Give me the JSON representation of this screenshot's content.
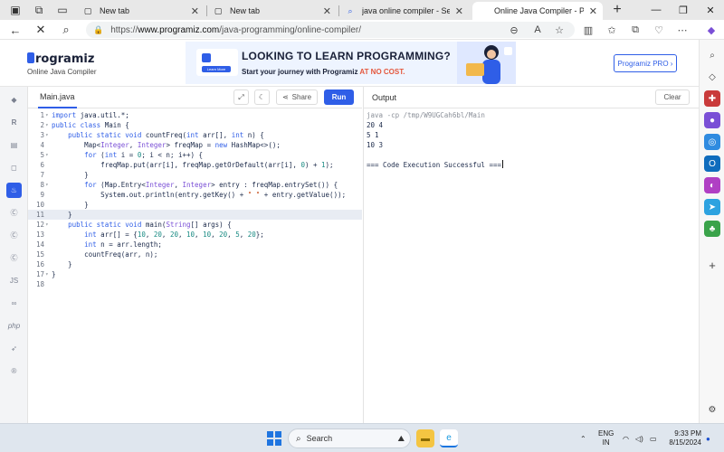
{
  "browser": {
    "tabs": [
      {
        "title": "New tab",
        "favicon": "page-icon"
      },
      {
        "title": "New tab",
        "favicon": "page-icon"
      },
      {
        "title": "java online compiler - Search",
        "favicon": "search-icon"
      },
      {
        "title": "Online Java Compiler - Program",
        "favicon": "programiz-icon",
        "active": true
      }
    ],
    "url_protocol": "https://",
    "url_host": "www.programiz.com",
    "url_path": "/java-programming/online-compiler/",
    "window_controls": [
      "—",
      "❐",
      "✕"
    ]
  },
  "site": {
    "logo_text": "rogramiz",
    "logo_sub": "Online Java Compiler",
    "banner": {
      "headline": "LOOKING TO LEARN PROGRAMMING?",
      "sub_prefix": "Start your journey with Programiz ",
      "sub_highlight": "AT NO COST.",
      "mini_button": "Learn More"
    },
    "pro_button": "Programiz PRO ›"
  },
  "editor": {
    "file_name": "Main.java",
    "share_label": "Share",
    "run_label": "Run",
    "current_line": 11,
    "lines": [
      {
        "n": "1",
        "fold": "▾",
        "html": "<span class=\"kw\">import</span> java.util.*;"
      },
      {
        "n": "2",
        "fold": "▾",
        "html": "<span class=\"kw\">public class</span> Main {"
      },
      {
        "n": "3",
        "fold": "▾",
        "html": "    <span class=\"kw\">public static void</span> countFreq(<span class=\"kw\">int</span> arr[], <span class=\"kw\">int</span> n) {"
      },
      {
        "n": "4",
        "fold": "",
        "html": "        Map&lt;<span class=\"ty\">Integer</span>, <span class=\"ty\">Integer</span>&gt; freqMap = <span class=\"kw\">new</span> HashMap&lt;&gt;();"
      },
      {
        "n": "5",
        "fold": "▾",
        "html": "        <span class=\"kw\">for</span> (<span class=\"kw\">int</span> i = <span class=\"num\">0</span>; i &lt; n; i++) {"
      },
      {
        "n": "6",
        "fold": "",
        "html": "            freqMap.put(arr[i], freqMap.getOrDefault(arr[i], <span class=\"num\">0</span>) + <span class=\"num\">1</span>);"
      },
      {
        "n": "7",
        "fold": "",
        "html": "        }"
      },
      {
        "n": "8",
        "fold": "▾",
        "html": "        <span class=\"kw\">for</span> (Map.Entry&lt;<span class=\"ty\">Integer</span>, <span class=\"ty\">Integer</span>&gt; entry : freqMap.entrySet()) {"
      },
      {
        "n": "9",
        "fold": "",
        "html": "            System.out.println(entry.getKey() + <span class=\"str\">\" \"</span> + entry.getValue());"
      },
      {
        "n": "10",
        "fold": "",
        "html": "        }"
      },
      {
        "n": "11",
        "fold": "",
        "html": "    }"
      },
      {
        "n": "12",
        "fold": "▾",
        "html": "    <span class=\"kw\">public static void</span> main(<span class=\"ty\">String</span>[] args) {"
      },
      {
        "n": "13",
        "fold": "",
        "html": "        <span class=\"kw\">int</span> arr[] = {<span class=\"num\">10</span>, <span class=\"num\">20</span>, <span class=\"num\">20</span>, <span class=\"num\">10</span>, <span class=\"num\">10</span>, <span class=\"num\">20</span>, <span class=\"num\">5</span>, <span class=\"num\">20</span>};"
      },
      {
        "n": "14",
        "fold": "",
        "html": "        <span class=\"kw\">int</span> n = arr.length;"
      },
      {
        "n": "15",
        "fold": "",
        "html": "        countFreq(arr, n);"
      },
      {
        "n": "16",
        "fold": "",
        "html": "    }"
      },
      {
        "n": "17",
        "fold": "▾",
        "html": "}"
      },
      {
        "n": "18",
        "fold": "",
        "html": ""
      }
    ]
  },
  "output": {
    "label": "Output",
    "clear_label": "Clear",
    "command": "java -cp /tmp/W9UGCah6bl/Main",
    "lines": [
      "20 4",
      "5 1",
      "10 3",
      "",
      "=== Code Execution Successful ==="
    ]
  },
  "rail_items": [
    "python",
    "R",
    "sql",
    "html",
    "java",
    "C",
    "C++",
    "C#",
    "JS",
    "go",
    "php",
    "swift",
    "rust"
  ],
  "taskbar": {
    "search_placeholder": "Search",
    "lang_top": "ENG",
    "lang_bottom": "IN",
    "time": "9:33 PM",
    "date": "8/15/2024"
  },
  "colors": {
    "accent": "#2f5ee7",
    "highlight": "#e4573d"
  }
}
